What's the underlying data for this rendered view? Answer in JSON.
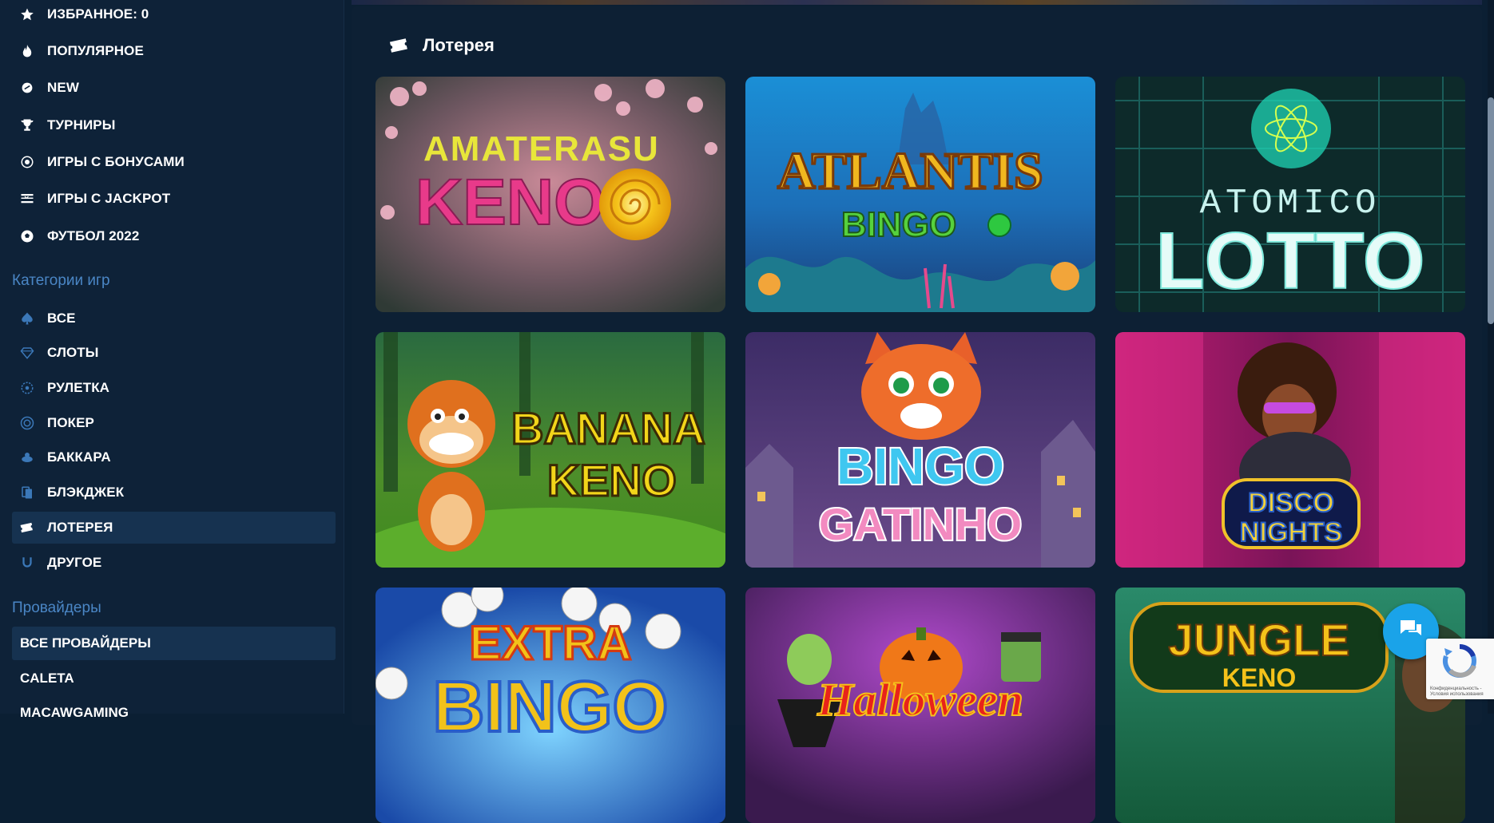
{
  "sidebar": {
    "main_nav": [
      {
        "label": "ИЗБРАННОЕ: 0",
        "icon": "star-icon"
      },
      {
        "label": "ПОПУЛЯРНОЕ",
        "icon": "fire-icon"
      },
      {
        "label": "NEW",
        "icon": "new-icon"
      },
      {
        "label": "ТУРНИРЫ",
        "icon": "trophy-icon"
      },
      {
        "label": "ИГРЫ С БОНУСАМИ",
        "icon": "bonus-icon"
      },
      {
        "label": "ИГРЫ С JACKPOT",
        "icon": "jackpot-icon"
      },
      {
        "label": "ФУТБОЛ 2022",
        "icon": "football-icon"
      }
    ],
    "categories_title": "Категории игр",
    "categories": [
      {
        "label": "ВСЕ",
        "icon": "spade-icon"
      },
      {
        "label": "СЛОТЫ",
        "icon": "diamond-icon"
      },
      {
        "label": "РУЛЕТКА",
        "icon": "roulette-icon"
      },
      {
        "label": "ПОКЕР",
        "icon": "poker-chip-icon"
      },
      {
        "label": "БАККАРА",
        "icon": "baccarat-icon"
      },
      {
        "label": "БЛЭКДЖЕК",
        "icon": "cards-icon"
      },
      {
        "label": "ЛОТЕРЕЯ",
        "icon": "ticket-icon",
        "active": true
      },
      {
        "label": "ДРУГОЕ",
        "icon": "horseshoe-icon"
      }
    ],
    "providers_title": "Провайдеры",
    "providers": [
      {
        "label": "ВСЕ ПРОВАЙДЕРЫ",
        "active": true
      },
      {
        "label": "CALETA"
      },
      {
        "label": "MACAWGAMING"
      }
    ]
  },
  "main": {
    "heading": "Лотерея",
    "heading_icon": "ticket-icon",
    "games": [
      {
        "title_line1": "AMATERASU",
        "title_line2": "KENO"
      },
      {
        "title_line1": "ATLANTIS",
        "title_line2": "BINGO"
      },
      {
        "title_line1": "ATOMICO",
        "title_line2": "LOTTO"
      },
      {
        "title_line1": "BANANA",
        "title_line2": "KENO"
      },
      {
        "title_line1": "BINGO",
        "title_line2": "GATINHO"
      },
      {
        "title_line1": "DISCO",
        "title_line2": "NIGHTS"
      },
      {
        "title_line1": "EXTRA",
        "title_line2": "BINGO"
      },
      {
        "title_line1": "Halloween",
        "title_line2": ""
      },
      {
        "title_line1": "JUNGLE",
        "title_line2": "KENO"
      }
    ]
  },
  "recaptcha": {
    "text": "Конфиденциальность - Условия использования"
  },
  "colors": {
    "accent": "#1aa3e9",
    "section_title": "#4a86c5",
    "active_bg": "#163250",
    "page_bg": "#0b1f33"
  }
}
